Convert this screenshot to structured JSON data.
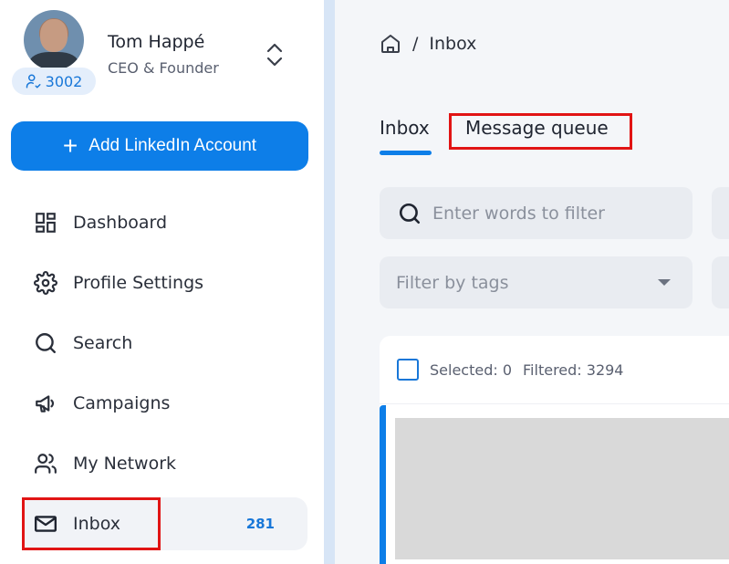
{
  "profile": {
    "name": "Tom Happé",
    "role": "CEO & Founder",
    "connections": "3002"
  },
  "sidebar": {
    "add_account_label": "Add LinkedIn Account",
    "items": [
      {
        "label": "Dashboard",
        "icon": "dashboard-icon"
      },
      {
        "label": "Profile Settings",
        "icon": "gear-icon"
      },
      {
        "label": "Search",
        "icon": "search-icon"
      },
      {
        "label": "Campaigns",
        "icon": "megaphone-icon"
      },
      {
        "label": "My Network",
        "icon": "people-icon"
      },
      {
        "label": "Inbox",
        "icon": "envelope-icon",
        "count": "281",
        "active": true
      }
    ]
  },
  "breadcrumb": {
    "current": "Inbox"
  },
  "tabs": [
    {
      "label": "Inbox",
      "active": true
    },
    {
      "label": "Message queue",
      "active": false
    }
  ],
  "filters": {
    "search_placeholder": "Enter words to filter",
    "tags_placeholder": "Filter by tags"
  },
  "list": {
    "selected_text": "Selected: 0",
    "filtered_text": "Filtered: 3294"
  },
  "colors": {
    "accent": "#0d7ee8",
    "highlight": "#e11414",
    "divider": "#d7e5f6"
  }
}
